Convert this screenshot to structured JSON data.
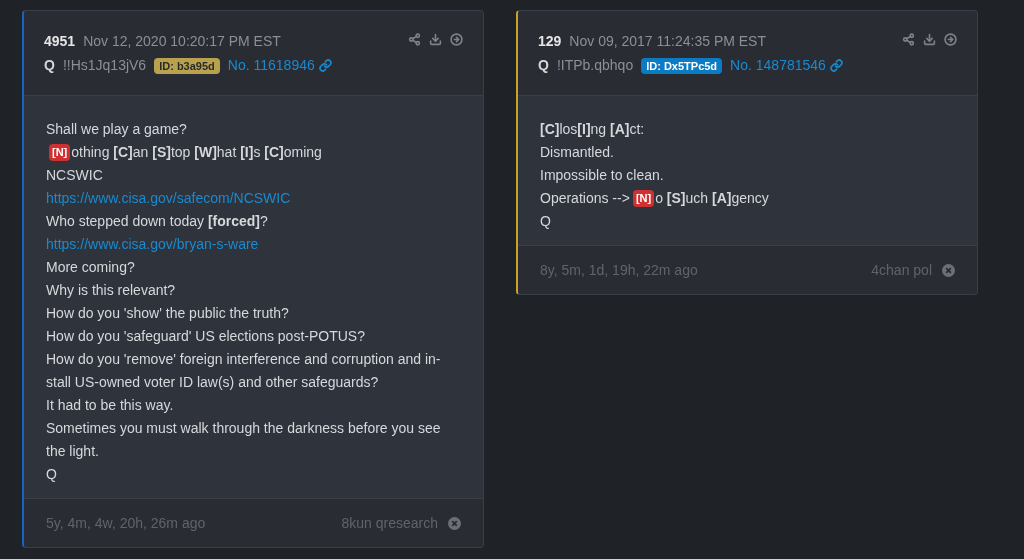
{
  "posts": [
    {
      "number": "4951",
      "date": "Nov 12, 2020 10:20:17 PM EST",
      "author": "Q",
      "tripcode": "!!Hs1Jq13jV6",
      "id_badge": {
        "text": "ID: b3a95d",
        "color": "#b8a24e"
      },
      "color": "#1565c0",
      "post_no": "No. 11618946",
      "lines": [
        [
          {
            "kind": "text",
            "text": "Shall we play a game?"
          }
        ],
        [
          {
            "kind": "tag",
            "text": "[N]"
          },
          {
            "kind": "text",
            "text": "othing **[C]**an **[S]**top **[W]**hat **[I]**s **[C]**oming"
          }
        ],
        [
          {
            "kind": "text",
            "text": "NCSWIC"
          }
        ],
        [
          {
            "kind": "link",
            "text": "https://www.cisa.gov/safecom/NCSWIC"
          }
        ],
        [
          {
            "kind": "text",
            "text": "Who stepped down today **[forced]**?"
          }
        ],
        [
          {
            "kind": "link",
            "text": "https://www.cisa.gov/bryan-s-ware"
          }
        ],
        [
          {
            "kind": "text",
            "text": "More coming?"
          }
        ],
        [
          {
            "kind": "text",
            "text": "Why is this relevant?"
          }
        ],
        [
          {
            "kind": "text",
            "text": "How do you 'show' the public the truth?"
          }
        ],
        [
          {
            "kind": "text",
            "text": "How do you 'safeguard' US elections post-POTUS?"
          }
        ],
        [
          {
            "kind": "text",
            "text": "How do you 'remove' foreign interference and corruption and in-stall US-owned voter ID law(s) and other safeguards?"
          }
        ],
        [
          {
            "kind": "text",
            "text": "It had to be this way."
          }
        ],
        [
          {
            "kind": "text",
            "text": "Sometimes you must walk through the darkness before you see the light."
          }
        ],
        [
          {
            "kind": "text",
            "text": "Q"
          }
        ]
      ],
      "age": "5y, 4m, 4w, 20h, 26m ago",
      "source": "8kun qresearch"
    },
    {
      "number": "129",
      "date": "Nov 09, 2017 11:24:35 PM EST",
      "author": "Q",
      "tripcode": "!ITPb.qbhqo",
      "id_badge": {
        "text": "ID: Dx5TPc5d",
        "color": "#0b7cc4"
      },
      "color": "#c9a227",
      "post_no": "No. 148781546",
      "lines": [
        [
          {
            "kind": "text",
            "text": "**[C]**los**[I]**ng **[A]**ct:"
          }
        ],
        [
          {
            "kind": "text",
            "text": "Dismantled."
          }
        ],
        [
          {
            "kind": "text",
            "text": "Impossible to clean."
          }
        ],
        [
          {
            "kind": "text",
            "text": "Operations -->"
          },
          {
            "kind": "tag",
            "text": "[N]"
          },
          {
            "kind": "text",
            "text": "o **[S]**uch **[A]**gency"
          }
        ],
        [
          {
            "kind": "text",
            "text": "Q"
          }
        ]
      ],
      "age": "8y, 5m, 1d, 19h, 22m ago",
      "source": "4chan pol"
    }
  ]
}
